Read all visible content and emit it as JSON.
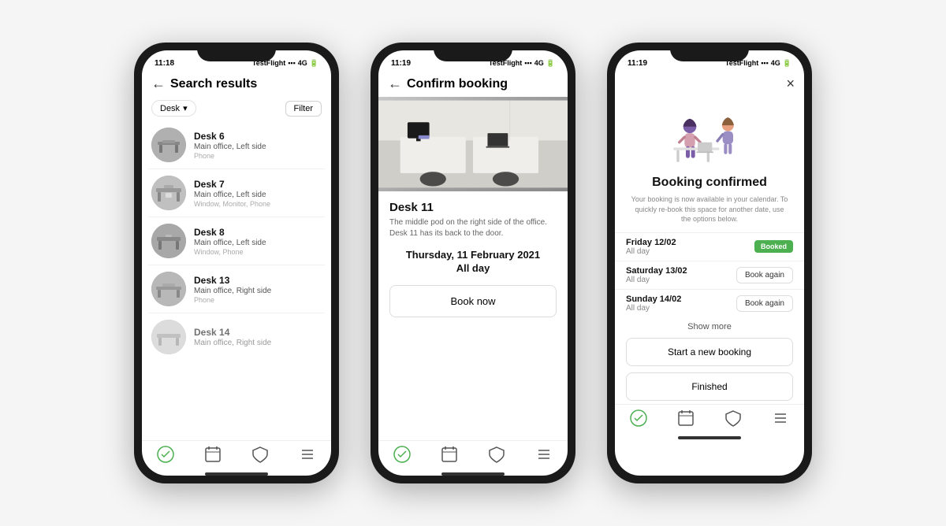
{
  "phone1": {
    "status": {
      "time": "11:18",
      "carrier": "TestFlight",
      "signal": "4G",
      "battery": "▪"
    },
    "header": {
      "back_label": "←",
      "title": "Search results"
    },
    "filter": {
      "chip_label": "Desk",
      "chip_arrow": "▾",
      "filter_btn": "Filter"
    },
    "desks": [
      {
        "name": "Desk 6",
        "location": "Main office, Left side",
        "amenities": "Phone"
      },
      {
        "name": "Desk 7",
        "location": "Main office, Left side",
        "amenities": "Window, Monitor, Phone"
      },
      {
        "name": "Desk 8",
        "location": "Main office, Left side",
        "amenities": "Window, Phone"
      },
      {
        "name": "Desk 13",
        "location": "Main office, Right side",
        "amenities": "Phone"
      },
      {
        "name": "Desk 14",
        "location": "Main office, Right side",
        "amenities": ""
      }
    ],
    "nav": {
      "check": "✓",
      "calendar": "📅",
      "shield": "⛨",
      "menu": "≡"
    }
  },
  "phone2": {
    "status": {
      "time": "11:19",
      "carrier": "TestFlight"
    },
    "header": {
      "back_label": "←",
      "title": "Confirm booking"
    },
    "desk_name": "Desk 11",
    "desk_desc": "The middle pod on the right side of the office. Desk 11 has its back to the door.",
    "date": "Thursday, 11 February 2021",
    "time_slot": "All day",
    "book_btn": "Book now"
  },
  "phone3": {
    "status": {
      "time": "11:19",
      "carrier": "TestFlight"
    },
    "header": {
      "close_label": "×"
    },
    "confirmed_title": "Booking confirmed",
    "confirmed_subtitle": "Your booking is now available in your calendar. To quickly re-book this space for another date, use the options below.",
    "dates": [
      {
        "label": "Friday 12/02",
        "sub": "All day",
        "action": "Booked",
        "is_booked": true
      },
      {
        "label": "Saturday 13/02",
        "sub": "All day",
        "action": "Book again",
        "is_booked": false
      },
      {
        "label": "Sunday 14/02",
        "sub": "All day",
        "action": "Book again",
        "is_booked": false
      }
    ],
    "show_more": "Show more",
    "new_booking_btn": "Start a new booking",
    "finished_btn": "Finished"
  }
}
